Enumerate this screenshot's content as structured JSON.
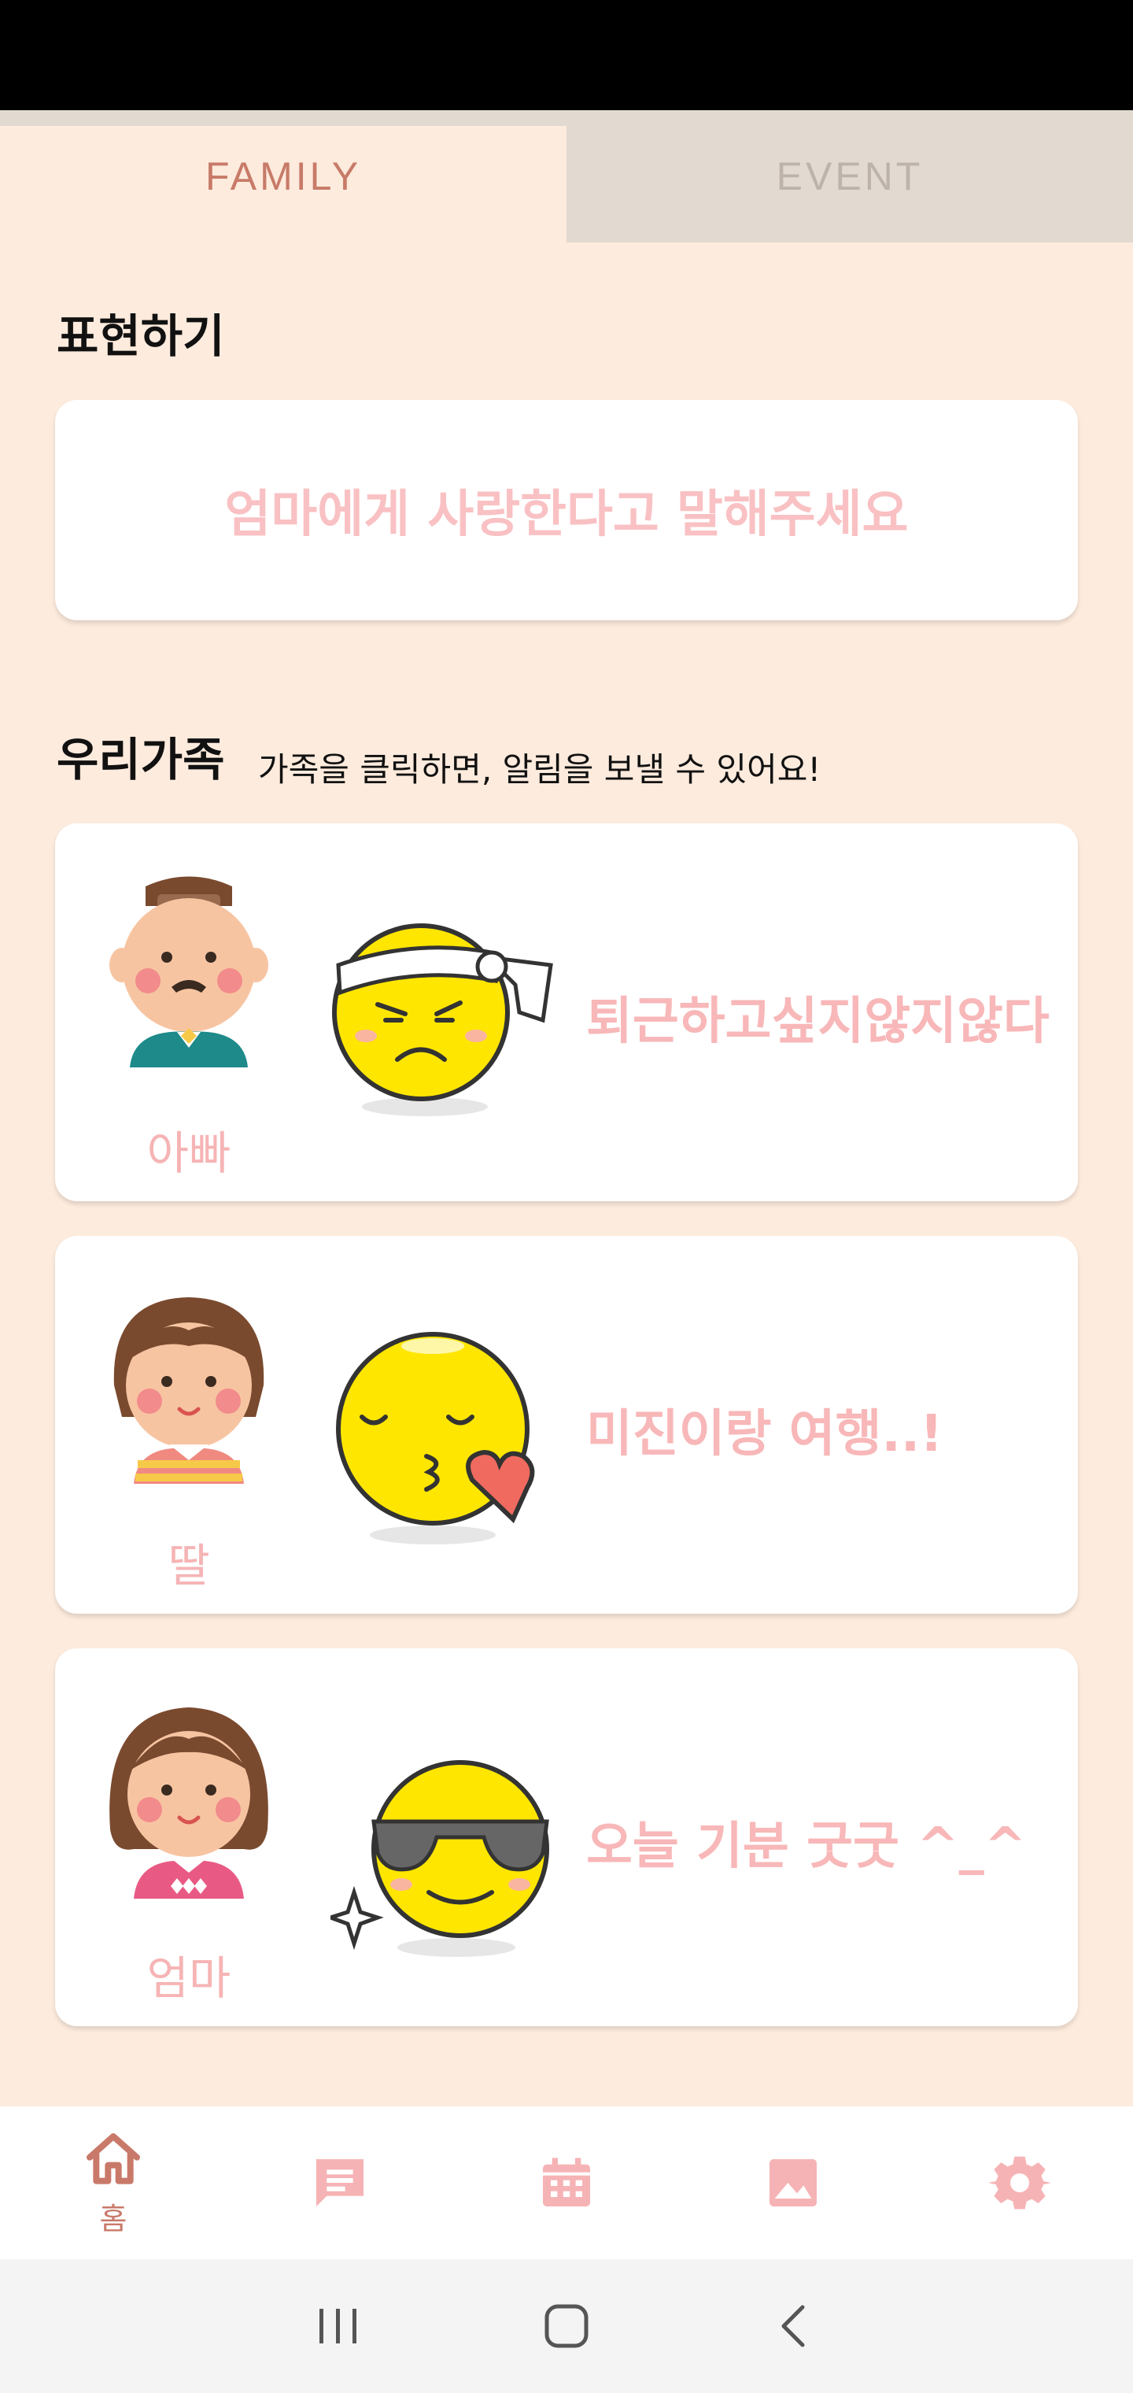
{
  "tabs": [
    {
      "label": "FAMILY",
      "active": true
    },
    {
      "label": "EVENT",
      "active": false
    }
  ],
  "express": {
    "title": "표현하기",
    "message": "엄마에게 사랑한다고 말해주세요"
  },
  "family": {
    "title": "우리가족",
    "hint": "가족을 클릭하면, 알림을 보낼 수 있어요!",
    "members": [
      {
        "name": "아빠",
        "avatar_icon": "dad-avatar",
        "emoji_icon": "headband-frown-emoji",
        "status": "퇴근하고싶지않지않다"
      },
      {
        "name": "딸",
        "avatar_icon": "daughter-avatar",
        "emoji_icon": "kiss-heart-emoji",
        "status": "미진이랑 여행..!"
      },
      {
        "name": "엄마",
        "avatar_icon": "mom-avatar",
        "emoji_icon": "sunglasses-emoji",
        "status": "오늘 기분 굿굿 ^_^"
      }
    ]
  },
  "bottom_nav": {
    "items": [
      {
        "icon": "home-icon",
        "label": "홈",
        "active": true
      },
      {
        "icon": "chat-icon",
        "label": "",
        "active": false
      },
      {
        "icon": "calendar-icon",
        "label": "",
        "active": false
      },
      {
        "icon": "image-icon",
        "label": "",
        "active": false
      },
      {
        "icon": "settings-icon",
        "label": "",
        "active": false
      }
    ]
  },
  "colors": {
    "background": "#FDEBDD",
    "accent": "#C9796A",
    "nav_inactive": "#F6B3B5",
    "text_pink": "#F8B7B8"
  }
}
